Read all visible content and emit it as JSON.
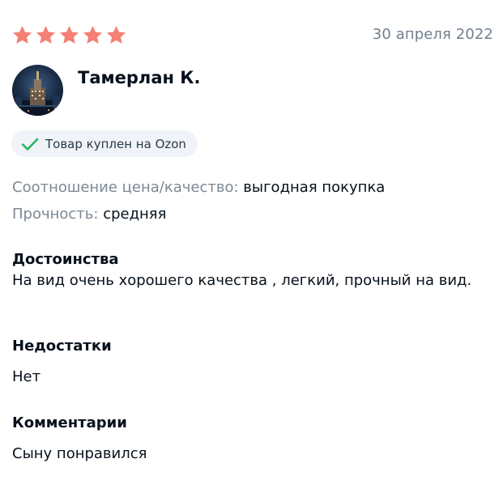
{
  "review": {
    "rating": 5,
    "rating_max": 5,
    "date": "30 апреля 2022",
    "author": "Тамерлан К.",
    "verified_badge": "Товар куплен на Ozon",
    "attributes": [
      {
        "label": "Соотношение цена/качество:",
        "value": "выгодная покупка"
      },
      {
        "label": "Прочность:",
        "value": "средняя"
      }
    ],
    "pros": {
      "title": "Достоинства",
      "text": "На вид очень хорошего качества , легкий, прочный на вид."
    },
    "cons": {
      "title": "Недостатки",
      "text": "Нет"
    },
    "comment": {
      "title": "Комментарии",
      "text": "Сыну понравился"
    }
  },
  "colors": {
    "star": "#f47f73",
    "check": "#22b35e",
    "badge_bg": "#f0f3f7",
    "muted_text": "#7c8894"
  },
  "icons": {
    "star": "star-icon",
    "check": "check-icon"
  }
}
